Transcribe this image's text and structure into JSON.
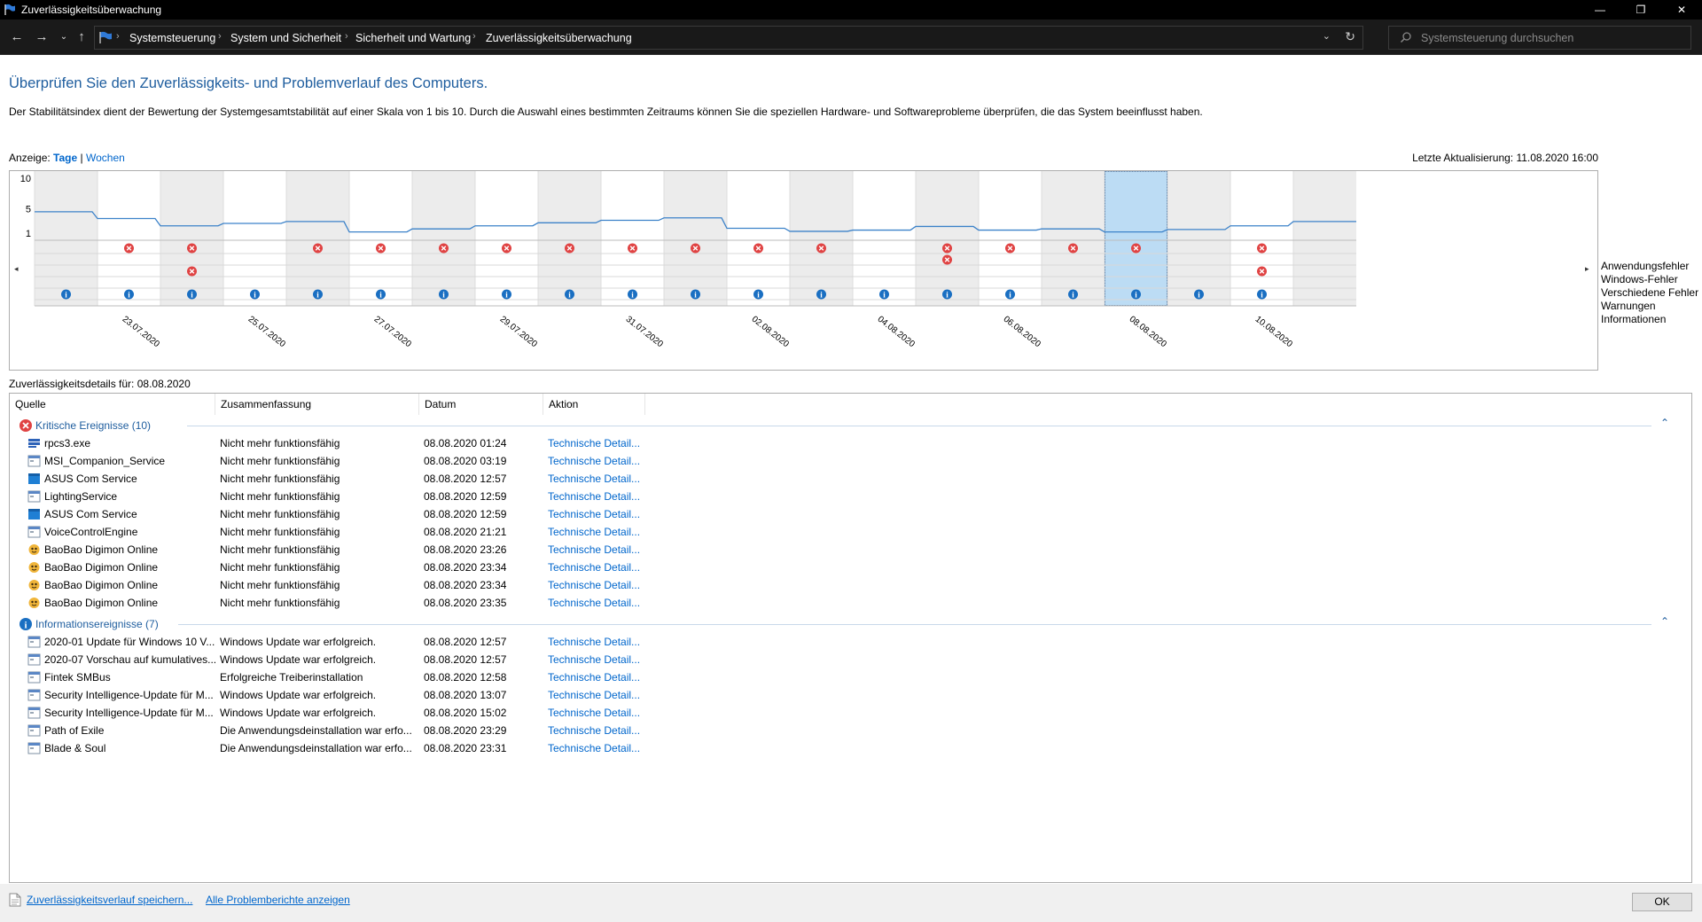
{
  "window": {
    "title": "Zuverlässigkeitsüberwachung"
  },
  "controls": {
    "minimize": "—",
    "maximize": "❐",
    "close": "✕"
  },
  "address": {
    "breadcrumbs": [
      "Systemsteuerung",
      "System und Sicherheit",
      "Sicherheit und Wartung",
      "Zuverlässigkeitsüberwachung"
    ],
    "search_placeholder": "Systemsteuerung durchsuchen"
  },
  "page": {
    "heading": "Überprüfen Sie den Zuverlässigkeits- und Problemverlauf des Computers.",
    "description": "Der Stabilitätsindex dient der Bewertung der Systemgesamtstabilität auf einer Skala von 1 bis 10. Durch die Auswahl eines bestimmten Zeitraums können Sie die speziellen Hardware- und Softwareprobleme überprüfen, die das System beeinflusst haben.",
    "view_label": "Anzeige:",
    "view_days": "Tage",
    "view_sep": "|",
    "view_weeks": "Wochen",
    "last_update": "Letzte Aktualisierung: 11.08.2020 16:00"
  },
  "chart_data": {
    "type": "line",
    "y_ticks": [
      "10",
      "5",
      "1"
    ],
    "ylim": [
      1,
      10
    ],
    "dates": [
      "22.07.2020",
      "23.07.2020",
      "24.07.2020",
      "25.07.2020",
      "26.07.2020",
      "27.07.2020",
      "28.07.2020",
      "29.07.2020",
      "30.07.2020",
      "31.07.2020",
      "01.08.2020",
      "02.08.2020",
      "03.08.2020",
      "04.08.2020",
      "05.08.2020",
      "06.08.2020",
      "07.08.2020",
      "08.08.2020",
      "09.08.2020",
      "10.08.2020",
      "11.08.2020"
    ],
    "x_labels": [
      "23.07.2020",
      "25.07.2020",
      "27.07.2020",
      "29.07.2020",
      "31.07.2020",
      "02.08.2020",
      "04.08.2020",
      "06.08.2020",
      "08.08.2020",
      "10.08.2020"
    ],
    "stability_index": [
      4.5,
      3.4,
      2.2,
      2.6,
      2.9,
      1.2,
      1.7,
      2.2,
      2.7,
      3.1,
      3.5,
      1.8,
      1.3,
      1.5,
      2.1,
      1.5,
      1.7,
      1.2,
      1.6,
      2.2,
      2.9
    ],
    "selected": "08.08.2020",
    "legend": [
      "Anwendungsfehler",
      "Windows-Fehler",
      "Verschiedene Fehler",
      "Warnungen",
      "Informationen"
    ],
    "events": {
      "Anwendungsfehler": [
        0,
        1,
        1,
        0,
        1,
        1,
        1,
        1,
        1,
        1,
        1,
        1,
        1,
        0,
        1,
        1,
        1,
        1,
        0,
        1,
        0
      ],
      "Windows-Fehler": [
        0,
        0,
        0,
        0,
        0,
        0,
        0,
        0,
        0,
        0,
        0,
        0,
        0,
        0,
        1,
        0,
        0,
        0,
        0,
        0,
        0
      ],
      "Verschiedene Fehler": [
        0,
        0,
        1,
        0,
        0,
        0,
        0,
        0,
        0,
        0,
        0,
        0,
        0,
        0,
        0,
        0,
        0,
        0,
        0,
        1,
        0
      ],
      "Warnungen": [
        0,
        0,
        0,
        0,
        0,
        0,
        0,
        0,
        0,
        0,
        0,
        0,
        0,
        0,
        0,
        0,
        0,
        0,
        0,
        0,
        0
      ],
      "Informationen": [
        1,
        1,
        1,
        1,
        1,
        1,
        1,
        1,
        1,
        1,
        1,
        1,
        1,
        1,
        1,
        1,
        1,
        1,
        1,
        1,
        0
      ]
    }
  },
  "details": {
    "label": "Zuverlässigkeitsdetails für: 08.08.2020",
    "columns": [
      "Quelle",
      "Zusammenfassung",
      "Datum",
      "Aktion"
    ],
    "groups": [
      {
        "label": "Kritische Ereignisse (10)",
        "type": "error",
        "rows": [
          {
            "source": "rpcs3.exe",
            "summary": "Nicht mehr funktionsfähig",
            "date": "08.08.2020 01:24",
            "action": "Technische Detail...",
            "icon": "app"
          },
          {
            "source": "MSI_Companion_Service",
            "summary": "Nicht mehr funktionsfähig",
            "date": "08.08.2020 03:19",
            "action": "Technische Detail...",
            "icon": "window"
          },
          {
            "source": "ASUS Com Service",
            "summary": "Nicht mehr funktionsfähig",
            "date": "08.08.2020 12:57",
            "action": "Technische Detail...",
            "icon": "blue-window"
          },
          {
            "source": "LightingService",
            "summary": "Nicht mehr funktionsfähig",
            "date": "08.08.2020 12:59",
            "action": "Technische Detail...",
            "icon": "window"
          },
          {
            "source": "ASUS Com Service",
            "summary": "Nicht mehr funktionsfähig",
            "date": "08.08.2020 12:59",
            "action": "Technische Detail...",
            "icon": "blue-window"
          },
          {
            "source": "VoiceControlEngine",
            "summary": "Nicht mehr funktionsfähig",
            "date": "08.08.2020 21:21",
            "action": "Technische Detail...",
            "icon": "window"
          },
          {
            "source": "BaoBao Digimon Online",
            "summary": "Nicht mehr funktionsfähig",
            "date": "08.08.2020 23:26",
            "action": "Technische Detail...",
            "icon": "game"
          },
          {
            "source": "BaoBao Digimon Online",
            "summary": "Nicht mehr funktionsfähig",
            "date": "08.08.2020 23:34",
            "action": "Technische Detail...",
            "icon": "game"
          },
          {
            "source": "BaoBao Digimon Online",
            "summary": "Nicht mehr funktionsfähig",
            "date": "08.08.2020 23:34",
            "action": "Technische Detail...",
            "icon": "game"
          },
          {
            "source": "BaoBao Digimon Online",
            "summary": "Nicht mehr funktionsfähig",
            "date": "08.08.2020 23:35",
            "action": "Technische Detail...",
            "icon": "game"
          }
        ]
      },
      {
        "label": "Informationsereignisse (7)",
        "type": "info",
        "rows": [
          {
            "source": "2020-01 Update für Windows 10 V...",
            "summary": "Windows Update war erfolgreich.",
            "date": "08.08.2020 12:57",
            "action": "Technische Detail...",
            "icon": "window"
          },
          {
            "source": "2020-07 Vorschau auf kumulatives...",
            "summary": "Windows Update war erfolgreich.",
            "date": "08.08.2020 12:57",
            "action": "Technische Detail...",
            "icon": "window"
          },
          {
            "source": "Fintek SMBus",
            "summary": "Erfolgreiche Treiberinstallation",
            "date": "08.08.2020 12:58",
            "action": "Technische Detail...",
            "icon": "window"
          },
          {
            "source": "Security Intelligence-Update für M...",
            "summary": "Windows Update war erfolgreich.",
            "date": "08.08.2020 13:07",
            "action": "Technische Detail...",
            "icon": "window"
          },
          {
            "source": "Security Intelligence-Update für M...",
            "summary": "Windows Update war erfolgreich.",
            "date": "08.08.2020 15:02",
            "action": "Technische Detail...",
            "icon": "window"
          },
          {
            "source": "Path of Exile",
            "summary": "Die Anwendungsdeinstallation war erfo...",
            "date": "08.08.2020 23:29",
            "action": "Technische Detail...",
            "icon": "window"
          },
          {
            "source": "Blade & Soul",
            "summary": "Die Anwendungsdeinstallation war erfo...",
            "date": "08.08.2020 23:31",
            "action": "Technische Detail...",
            "icon": "window"
          }
        ]
      }
    ]
  },
  "bottom": {
    "save_link": "Zuverlässigkeitsverlauf speichern...",
    "reports_link": "Alle Problemberichte anzeigen",
    "ok_label": "OK"
  },
  "colors": {
    "heading": "#1e5d9e",
    "link": "#0066cc",
    "error": "#e04343",
    "info": "#1a6fc2",
    "line": "#3c82c9",
    "selection": "#bcdcf4"
  }
}
